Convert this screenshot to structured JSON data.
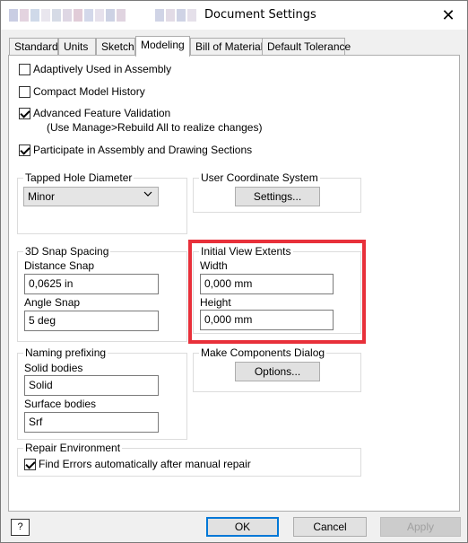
{
  "window": {
    "title": "Document Settings",
    "close_label": "✕"
  },
  "tabs": [
    {
      "label": "Standard"
    },
    {
      "label": "Units"
    },
    {
      "label": "Sketch"
    },
    {
      "label": "Modeling",
      "active": true
    },
    {
      "label": "Bill of Materials"
    },
    {
      "label": "Default Tolerance"
    }
  ],
  "modeling": {
    "checkboxes": [
      {
        "label": "Adaptively Used in Assembly",
        "checked": false
      },
      {
        "label": "Compact Model History",
        "checked": false
      },
      {
        "label": "Advanced Feature Validation",
        "checked": true
      },
      {
        "label": "Participate in Assembly and Drawing Sections",
        "checked": true
      }
    ],
    "advanced_note": "(Use Manage>Rebuild All to realize changes)",
    "tapped_hole": {
      "legend": "Tapped Hole Diameter",
      "selected": "Minor"
    },
    "ucs": {
      "legend": "User Coordinate System",
      "button": "Settings..."
    },
    "snap": {
      "legend": "3D Snap Spacing",
      "distance_label": "Distance Snap",
      "distance_value": "0,0625 in",
      "angle_label": "Angle Snap",
      "angle_value": "5 deg"
    },
    "view_extents": {
      "legend": "Initial View Extents",
      "width_label": "Width",
      "width_value": "0,000 mm",
      "height_label": "Height",
      "height_value": "0,000 mm"
    },
    "naming": {
      "legend": "Naming prefixing",
      "solid_label": "Solid bodies",
      "solid_value": "Solid",
      "surface_label": "Surface bodies",
      "surface_value": "Srf"
    },
    "make_components": {
      "legend": "Make Components Dialog",
      "button": "Options..."
    },
    "repair": {
      "legend": "Repair Environment",
      "checkbox_label": "Find Errors automatically after manual repair",
      "checked": true
    }
  },
  "footer": {
    "help_label": "?",
    "ok": "OK",
    "cancel": "Cancel",
    "apply": "Apply"
  },
  "colors": {
    "highlight": "#e8303a",
    "primary_border": "#0078d7"
  },
  "icons": {
    "close": "close-icon",
    "dropdown": "chevron-down-icon",
    "help": "help-icon",
    "check": "checkmark-icon"
  }
}
